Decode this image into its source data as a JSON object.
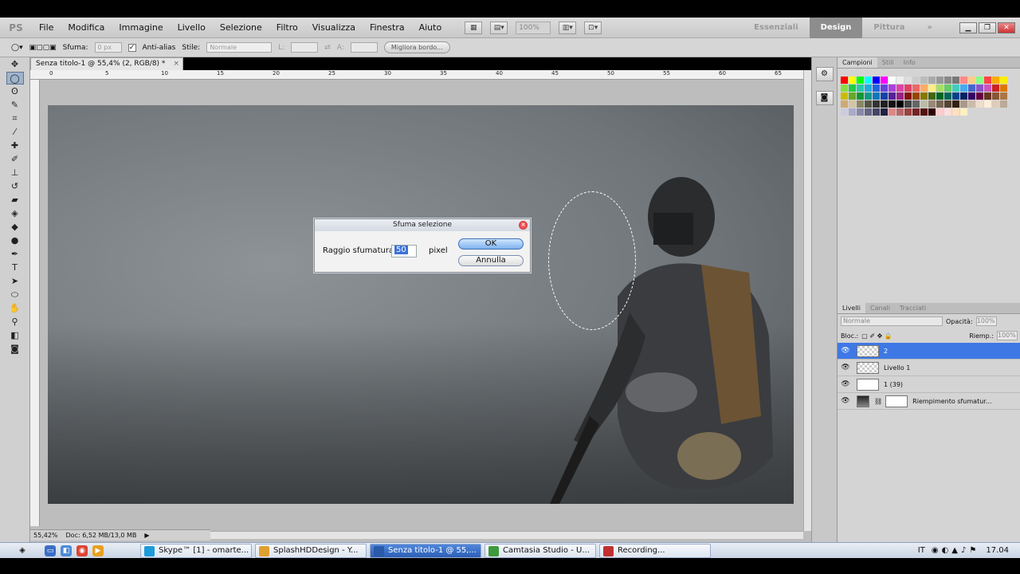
{
  "menubar": {
    "logo": "PS",
    "items": [
      "File",
      "Modifica",
      "Immagine",
      "Livello",
      "Selezione",
      "Filtro",
      "Visualizza",
      "Finestra",
      "Aiuto"
    ],
    "zoom": "100%",
    "workspaces": [
      "Essenziali",
      "Design",
      "Pittura"
    ],
    "active_workspace": "Design",
    "more": "»"
  },
  "options": {
    "feather_label": "Sfuma:",
    "feather_value": "0 px",
    "antialias_label": "Anti-alias",
    "style_label": "Stile:",
    "style_value": "Normale",
    "width_label": "L:",
    "height_label": "A:",
    "refine_button": "Migliora bordo..."
  },
  "document": {
    "tab_title": "Senza titolo-1 @ 55,4% (2, RGB/8) *",
    "ruler_ticks": [
      "0",
      "5",
      "10",
      "15",
      "20",
      "25",
      "30",
      "35",
      "40",
      "45",
      "50",
      "55",
      "60",
      "65"
    ],
    "status_zoom": "55,42%",
    "status_doc": "Doc: 6,52 MB/13,0 MB"
  },
  "dialog": {
    "title": "Sfuma selezione",
    "radius_label": "Raggio sfumatura:",
    "radius_value": "50",
    "unit": "pixel",
    "ok": "OK",
    "cancel": "Annulla"
  },
  "top_panel": {
    "tabs": [
      "Campioni",
      "Stili",
      "Info"
    ],
    "swatch_colors": [
      "#ff0000",
      "#ffff00",
      "#00ff00",
      "#00ffff",
      "#0000ff",
      "#ff00ff",
      "#ffffff",
      "#eeeeee",
      "#dddddd",
      "#cccccc",
      "#bbbbbb",
      "#aaaaaa",
      "#999999",
      "#888888",
      "#777777",
      "#ff8888",
      "#ffcc88",
      "#88ff88",
      "#ff4444",
      "#ffaa00",
      "#ffee00",
      "#88dd44",
      "#22cc44",
      "#22ccaa",
      "#22aadd",
      "#2266dd",
      "#6644dd",
      "#aa44dd",
      "#dd44aa",
      "#dd4466",
      "#ee6666",
      "#ffaa66",
      "#ffee88",
      "#aadd66",
      "#66cc66",
      "#44ccbb",
      "#44aaee",
      "#4466cc",
      "#8855cc",
      "#cc55bb",
      "#cc2222",
      "#dd7700",
      "#ccbb00",
      "#66aa22",
      "#119933",
      "#119988",
      "#1177bb",
      "#1144aa",
      "#552299",
      "#992288",
      "#881111",
      "#994400",
      "#887700",
      "#446611",
      "#006622",
      "#006655",
      "#004488",
      "#002266",
      "#330066",
      "#660044",
      "#663322",
      "#885533",
      "#aa7744",
      "#ccaa77",
      "#d4c4a0",
      "#888866",
      "#555544",
      "#333333",
      "#222222",
      "#111111",
      "#000000",
      "#444444",
      "#666666",
      "#bbbbaa",
      "#998877",
      "#776655",
      "#554433",
      "#332211",
      "#aa9988",
      "#ccbbaa",
      "#eeddcc",
      "#ffeedd",
      "#ddccbb",
      "#bbaa99",
      "#ccccdd",
      "#aaaacc",
      "#8888aa",
      "#666688",
      "#444466",
      "#222244",
      "#dd8888",
      "#bb6666",
      "#994444",
      "#772222",
      "#551111",
      "#330000",
      "#ffcccc",
      "#ffdddd",
      "#ffe0c0",
      "#fff0c0"
    ]
  },
  "layers": {
    "tabs": [
      "Livelli",
      "Canali",
      "Tracciati"
    ],
    "blend": "Normale",
    "opacity_label": "Opacità:",
    "opacity_value": "100%",
    "lock_label": "Bloc.:",
    "fill_label": "Riemp.:",
    "fill_value": "100%",
    "items": [
      {
        "name": "2",
        "selected": true
      },
      {
        "name": "Livello 1",
        "selected": false
      },
      {
        "name": "1 (39)",
        "selected": false
      },
      {
        "name": "Riempimento sfumatur...",
        "selected": false
      }
    ]
  },
  "taskbar": {
    "tasks": [
      {
        "label": "Skype™ [1] - omarte...",
        "color": "#1d9bd9"
      },
      {
        "label": "SplashHDDesign - Y...",
        "color": "#e0a030"
      },
      {
        "label": "Senza titolo-1 @ 55,...",
        "color": "#2a5aa8"
      },
      {
        "label": "Camtasia Studio - U...",
        "color": "#3d9a3d"
      },
      {
        "label": "Recording...",
        "color": "#c03030"
      }
    ],
    "lang": "IT",
    "clock": "17.04"
  }
}
